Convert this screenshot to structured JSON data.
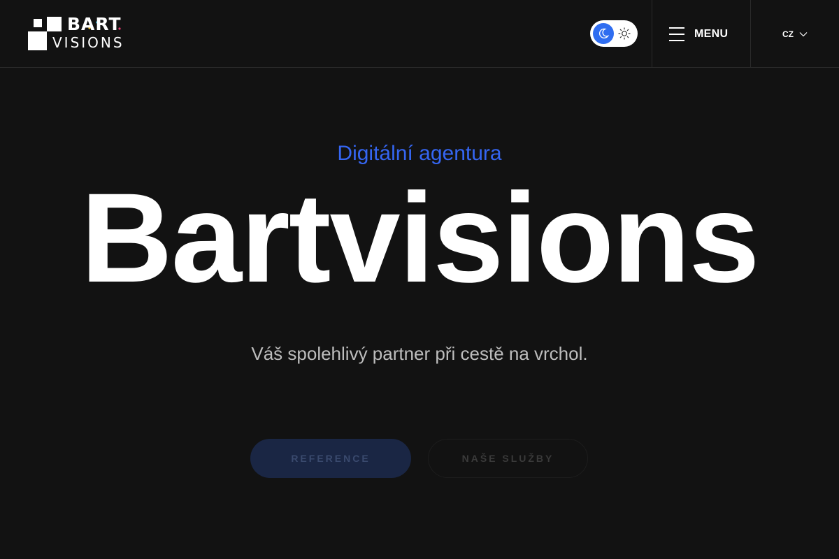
{
  "header": {
    "logo": {
      "top_text": "BART",
      "bottom_text": "VISIONS"
    },
    "theme_toggle": {
      "active": "dark",
      "dark_icon": "moon-icon",
      "light_icon": "sun-icon",
      "accent_color": "#2f6df0"
    },
    "menu": {
      "label": "MENU",
      "icon": "hamburger-icon"
    },
    "language": {
      "selected": "CZ",
      "icon": "chevron-down-icon"
    }
  },
  "hero": {
    "eyebrow": "Digitální agentura",
    "title": "Bartvisions",
    "tagline": "Váš spolehlivý partner při cestě na vrchol.",
    "buttons": {
      "primary_label": "REFERENCE",
      "secondary_label": "NAŠE SLUŽBY"
    }
  },
  "colors": {
    "background": "#121212",
    "accent": "#3566f2",
    "text": "#ffffff",
    "muted_text": "#bdbdbd"
  }
}
